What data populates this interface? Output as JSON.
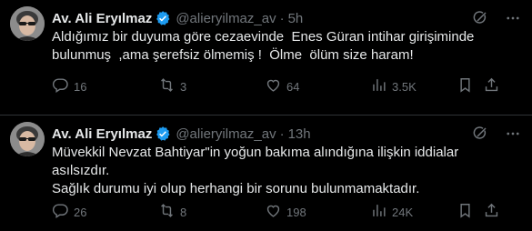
{
  "colors": {
    "background": "#000000",
    "text": "#e7e9ea",
    "muted": "#71767b",
    "verified": "#1d9bf0",
    "divider": "#2f3336"
  },
  "tweets": [
    {
      "author": "Av. Ali Eryılmaz",
      "handle": "@alieryilmaz_av",
      "separator": "·",
      "time": "5h",
      "lines": [
        "Aldığımız bir duyuma göre cezaevinde  Enes Güran intihar girişiminde",
        "bulunmuş  ,ama şerefsiz ölmemiş !  Ölme  ölüm size haram!"
      ],
      "stats": {
        "replies": "16",
        "retweets": "3",
        "likes": "64",
        "views": "3.5K"
      },
      "icons": [
        "grok-icon",
        "more-icon",
        "reply-icon",
        "retweet-icon",
        "like-icon",
        "views-icon",
        "bookmark-icon",
        "share-icon"
      ]
    },
    {
      "author": "Av. Ali Eryılmaz",
      "handle": "@alieryilmaz_av",
      "separator": "·",
      "time": "13h",
      "lines": [
        "Müvekkil Nevzat Bahtiyar\"in yoğun bakıma alındığına ilişkin iddialar",
        "asılsızdır.",
        "Sağlık durumu iyi olup herhangi bir sorunu bulunmamaktadır."
      ],
      "stats": {
        "replies": "26",
        "retweets": "8",
        "likes": "198",
        "views": "24K"
      },
      "icons": [
        "grok-icon",
        "more-icon",
        "reply-icon",
        "retweet-icon",
        "like-icon",
        "views-icon",
        "bookmark-icon",
        "share-icon"
      ]
    }
  ]
}
